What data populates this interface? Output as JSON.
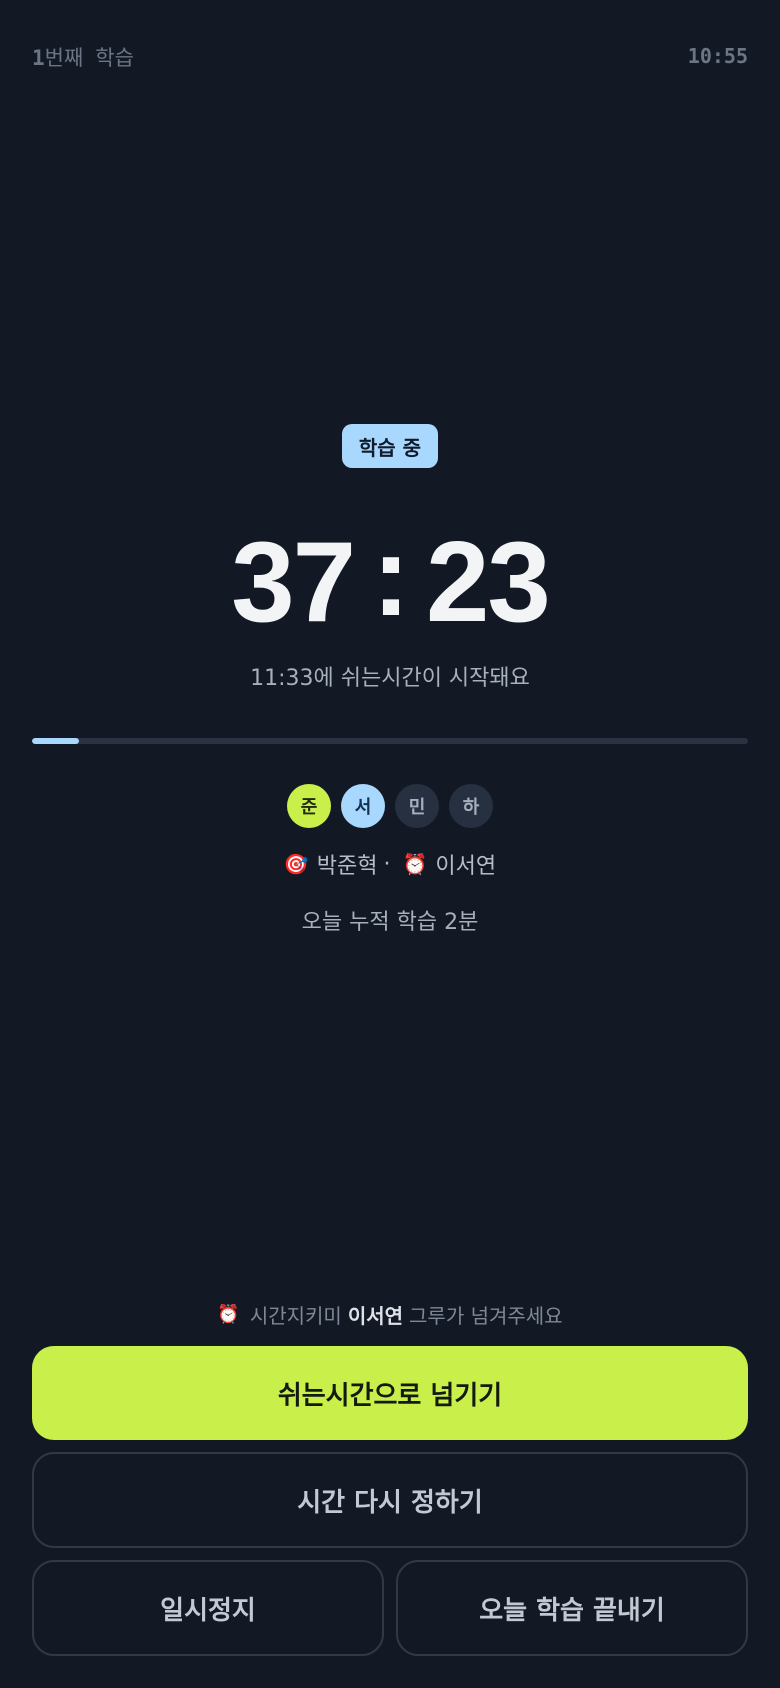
{
  "status": {
    "session_number": "1",
    "session_label": "번째",
    "session_suffix": "학습",
    "clock": "10:55"
  },
  "state_badge": "학습 중",
  "timer": {
    "minutes": "37",
    "separator": ":",
    "seconds": "23"
  },
  "break_notice": "11:33에 쉬는시간이 시작돼요",
  "progress": {
    "fraction": 0.065,
    "color": "#a9d8ff"
  },
  "members": [
    {
      "initial": "준",
      "style": "lime"
    },
    {
      "initial": "서",
      "style": "blue"
    },
    {
      "initial": "민",
      "style": "dark"
    },
    {
      "initial": "하",
      "style": "dark"
    }
  ],
  "roles": {
    "leader_icon": "target-icon",
    "leader_emoji": "🎯",
    "leader_name": "박준혁",
    "separator": "·",
    "timekeeper_icon": "alarm-clock-icon",
    "timekeeper_emoji": "⏰",
    "timekeeper_name": "이서연"
  },
  "today_total": "오늘 누적 학습 2분",
  "hint": {
    "emoji": "⏰",
    "prefix": "시간지키미",
    "name": "이서연",
    "suffix": "그루가 넘겨주세요"
  },
  "buttons": {
    "to_break": "쉬는시간으로 넘기기",
    "reset_time": "시간 다시 정하기",
    "pause": "일시정지",
    "end_today": "오늘 학습 끝내기"
  },
  "colors": {
    "background": "#131924",
    "accent_lime": "#c9ef4a",
    "accent_blue": "#a9d8ff"
  }
}
